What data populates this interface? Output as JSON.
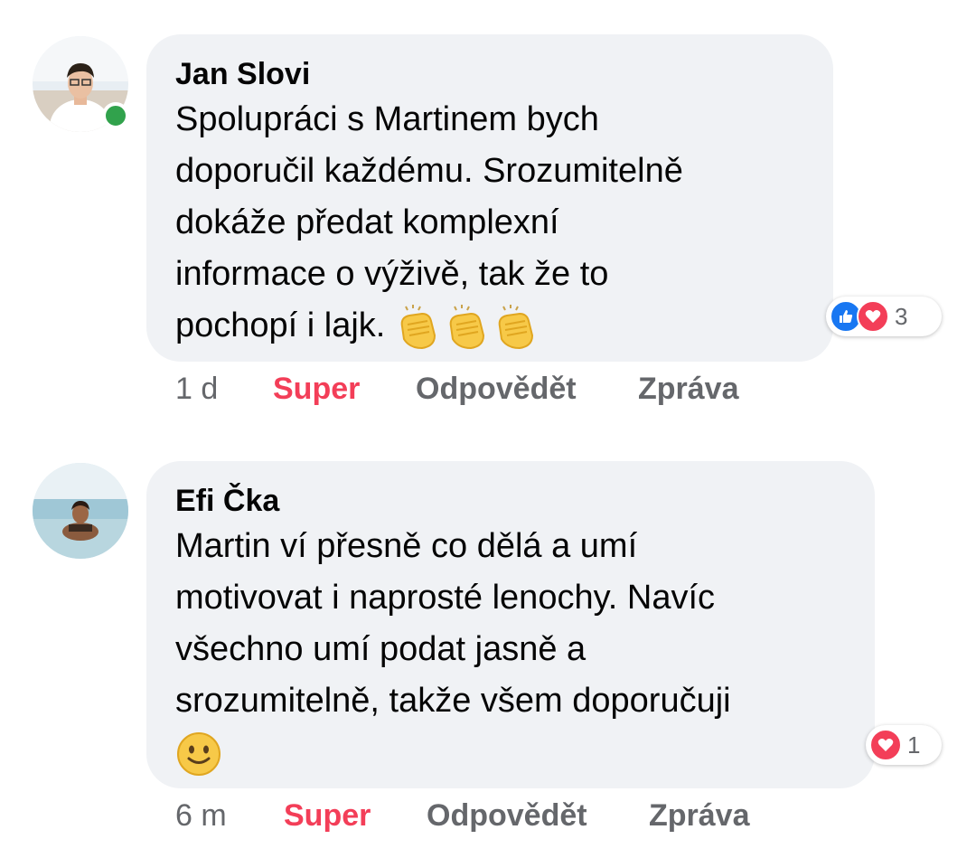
{
  "comments": [
    {
      "author": "Jan Slovi",
      "lines": [
        "Spolupráci s Martinem bych",
        "doporučil každému. Srozumitelně",
        "dokáže předat komplexní",
        "informace o výživě, tak že to",
        "pochopí i lajk."
      ],
      "emojis": [
        "clapping-hands",
        "clapping-hands",
        "clapping-hands"
      ],
      "reaction_count": "3",
      "reaction_types": [
        "like",
        "love"
      ],
      "time": "1 d",
      "reaction_label": "Super",
      "reply_label": "Odpovědět",
      "message_label": "Zpráva",
      "online": true
    },
    {
      "author": "Efi Čka",
      "lines": [
        "Martin ví přesně co dělá a umí",
        "motivovat i naprosté lenochy. Navíc",
        "všechno umí podat jasně a",
        "srozumitelně, takže všem doporučuji"
      ],
      "emojis": [
        "slightly-smiling-face"
      ],
      "reaction_count": "1",
      "reaction_types": [
        "love"
      ],
      "time": "6 m",
      "reaction_label": "Super",
      "reply_label": "Odpovědět",
      "message_label": "Zpráva",
      "online": false
    }
  ],
  "colors": {
    "bubble": "#f0f2f5",
    "text": "#050505",
    "meta": "#65676b",
    "super": "#f33e58",
    "like": "#1877f2",
    "online": "#31a24c"
  }
}
